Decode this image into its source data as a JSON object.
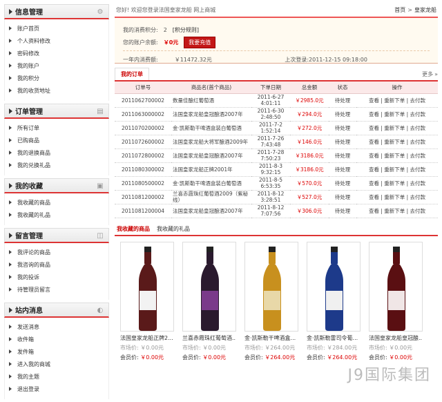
{
  "sidebar": [
    {
      "title": "信息管理",
      "icon": "gear-icon",
      "items": [
        "账户首页",
        "个人资料修改",
        "密码修改",
        "我的账户",
        "我的积分",
        "我的收货地址"
      ]
    },
    {
      "title": "订单管理",
      "icon": "download-icon",
      "items": [
        "所有订单",
        "已购商品",
        "我的退换商品",
        "我的兑换礼品"
      ]
    },
    {
      "title": "我的收藏",
      "icon": "card-icon",
      "items": [
        "我收藏的商品",
        "我收藏的礼品"
      ]
    },
    {
      "title": "留言管理",
      "icon": "note-icon",
      "items": [
        "我评论的商品",
        "我咨询的商品",
        "我的投诉",
        "待管理员留言"
      ]
    },
    {
      "title": "站内消息",
      "icon": "chat-icon",
      "items": [
        "发送消息",
        "收件箱",
        "发件箱",
        "进入我的商城",
        "我的主题",
        "退出登录"
      ]
    }
  ],
  "topbar": {
    "greeting": "您好! 欢迎您登录法国皇家龙船  网上商城",
    "home": "首页",
    "sep": ">",
    "current": "皇家龙船"
  },
  "info": {
    "points_label": "我的消费积分:",
    "points": "2",
    "points_rule": "[积分规则]",
    "balance_label": "您的账户余额:",
    "balance": "￥0元",
    "recharge": "我要充值",
    "year_label": "一年内消费额:",
    "year_amount": "￥11472.32元",
    "last_login": "上次登录:2011-12-15 09:18:00"
  },
  "orders": {
    "tab": "我的订单",
    "more": "更多",
    "headers": [
      "订单号",
      "商品名(首个商品)",
      "下单日期",
      "总金额",
      "状态",
      "操作"
    ],
    "rows": [
      {
        "id": "2011062700002",
        "name": "数量佳酿红葡萄酒",
        "date": "2011-6-27\n4:01:11",
        "total": "￥2985.0元",
        "status": "待处理",
        "ops": "查看 | 重新下单 | 去付款"
      },
      {
        "id": "2011063000002",
        "name": "法国皇家龙船皇冠酿酒2007年",
        "date": "2011-6-30\n2:48:50",
        "total": "￥294.0元",
        "status": "待处理",
        "ops": "查看 | 重新下单 | 去付款"
      },
      {
        "id": "2011070200002",
        "name": "金·凯斯勒干啤酒盒装白葡萄酒",
        "date": "2011-7-2\n1:52:14",
        "total": "￥272.0元",
        "status": "待处理",
        "ops": "查看 | 重新下单 | 去付款"
      },
      {
        "id": "2011072600002",
        "name": "法国皇家龙船大将军酿酒2009年",
        "date": "2011-7-26\n7:43:48",
        "total": "￥146.0元",
        "status": "待处理",
        "ops": "查看 | 重新下单 | 去付款"
      },
      {
        "id": "2011072800002",
        "name": "法国皇家龙船皇冠酿酒2007年",
        "date": "2011-7-28\n7:50:23",
        "total": "￥3186.0元",
        "status": "待处理",
        "ops": "查看 | 重新下单 | 去付款"
      },
      {
        "id": "2011080300002",
        "name": "法国皇家龙船正牌2001年",
        "date": "2011-8-3\n9:32:15",
        "total": "￥3186.0元",
        "status": "待处理",
        "ops": "查看 | 重新下单 | 去付款"
      },
      {
        "id": "2011080500002",
        "name": "金·凯斯勒干啤酒盒装白葡萄酒",
        "date": "2011-8-5\n6:53:35",
        "total": "￥570.0元",
        "status": "待处理",
        "ops": "查看 | 重新下单 | 去付款"
      },
      {
        "id": "2011081200002",
        "name": "兰喜赤霞珠红葡萄酒2009（紫秘线）",
        "date": "2011-8-12\n3:28:51",
        "total": "￥527.0元",
        "status": "待处理",
        "ops": "查看 | 重新下单 | 去付款"
      },
      {
        "id": "2011081200004",
        "name": "法国皇家龙船皇冠酿酒2007年",
        "date": "2011-8-12\n7:07:56",
        "total": "￥306.0元",
        "status": "待处理",
        "ops": "查看 | 重新下单 | 去付款"
      }
    ]
  },
  "favorites": {
    "tabs": [
      "我收藏的商品",
      "我收藏的礼品"
    ],
    "items": [
      {
        "name": "法国皇家龙船正牌2...",
        "market": "市场价: ￥0.00元",
        "member_label": "会员价:",
        "member": "￥0.00元",
        "bottle": "#5a1a1a",
        "label": "#f2f2f2"
      },
      {
        "name": "兰喜赤霞珠红葡萄酒...",
        "market": "市场价: ￥0.00元",
        "member_label": "会员价:",
        "member": "￥0.00元",
        "bottle": "#2a1a2e",
        "label": "#7a3a8a"
      },
      {
        "name": "金·凯斯勒干啤酒盒...",
        "market": "市场价: ￥264.00元",
        "member_label": "会员价:",
        "member": "￥264.00元",
        "bottle": "#c8901e",
        "label": "#e8d8a8"
      },
      {
        "name": "金·凯斯勒雷司令葡...",
        "market": "市场价: ￥284.00元",
        "member_label": "会员价:",
        "member": "￥264.00元",
        "bottle": "#1d3a8a",
        "label": "#f0f0f0"
      },
      {
        "name": "法国皇家龙船皇冠酿...",
        "market": "市场价: ￥0.00元",
        "member_label": "会员价:",
        "member": "￥0.00元",
        "bottle": "#5a0f12",
        "label": "#f0e6e6"
      }
    ]
  },
  "watermark": "J9国际集团"
}
